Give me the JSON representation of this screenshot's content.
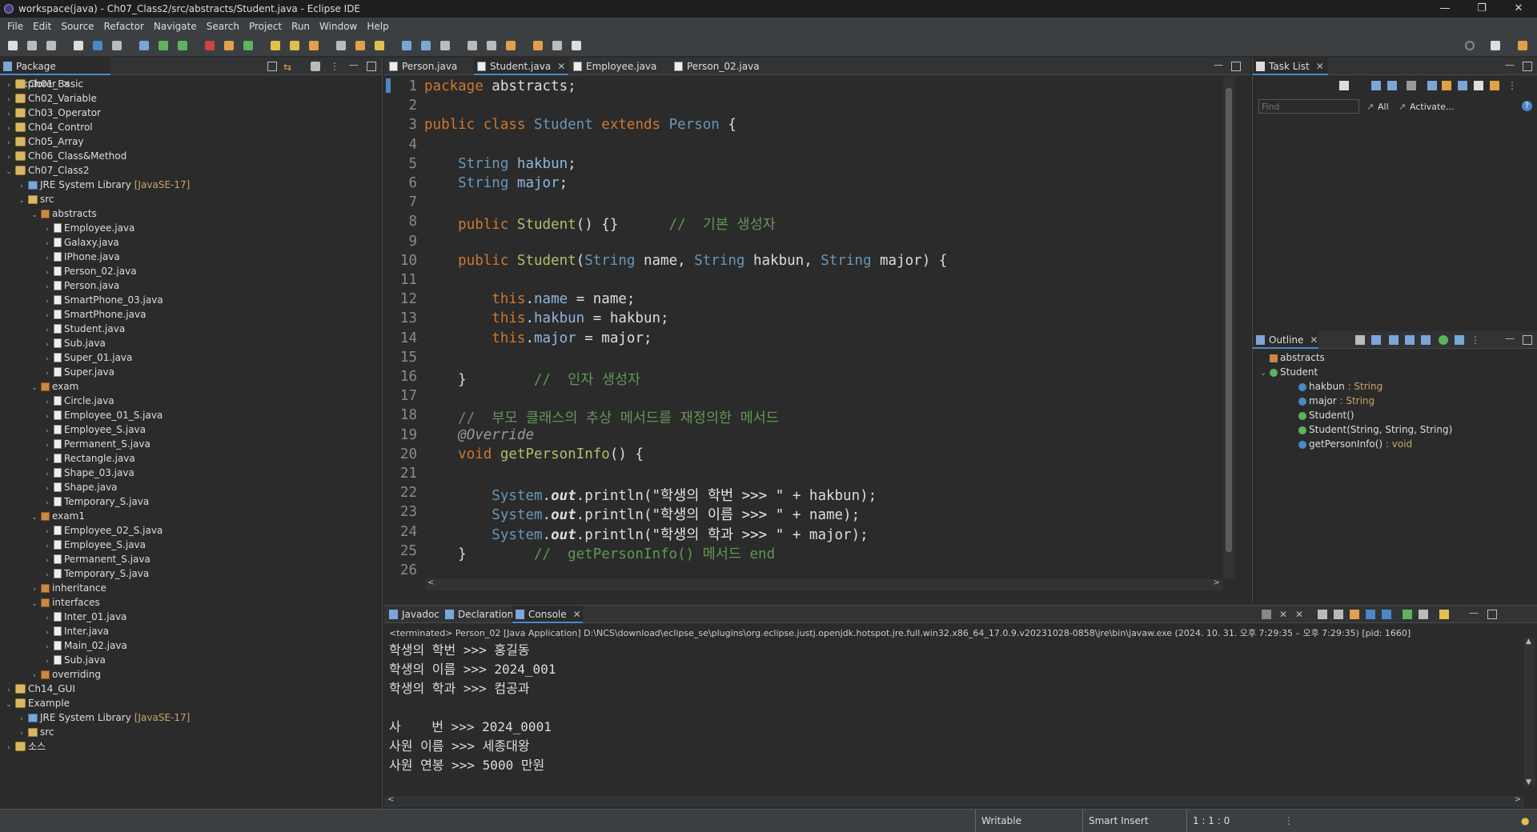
{
  "window": {
    "title": "workspace(java) - Ch07_Class2/src/abstracts/Student.java - Eclipse IDE"
  },
  "menu": {
    "items": [
      "File",
      "Edit",
      "Source",
      "Refactor",
      "Navigate",
      "Search",
      "Project",
      "Run",
      "Window",
      "Help"
    ]
  },
  "package_explorer": {
    "title": "Package Explorer",
    "rows": [
      {
        "label": "Ch01_Basic",
        "indent": 0,
        "icon": "project",
        "expanded": false
      },
      {
        "label": "Ch02_Variable",
        "indent": 0,
        "icon": "project",
        "expanded": false
      },
      {
        "label": "Ch03_Operator",
        "indent": 0,
        "icon": "project",
        "expanded": false
      },
      {
        "label": "Ch04_Control",
        "indent": 0,
        "icon": "project",
        "expanded": false
      },
      {
        "label": "Ch05_Array",
        "indent": 0,
        "icon": "project",
        "expanded": false
      },
      {
        "label": "Ch06_Class&Method",
        "indent": 0,
        "icon": "project",
        "expanded": false
      },
      {
        "label": "Ch07_Class2",
        "indent": 0,
        "icon": "project",
        "expanded": true
      },
      {
        "label": "JRE System Library",
        "note": "[JavaSE-17]",
        "indent": 1,
        "icon": "library",
        "expanded": false
      },
      {
        "label": "src",
        "indent": 1,
        "icon": "src",
        "expanded": true
      },
      {
        "label": "abstracts",
        "indent": 2,
        "icon": "package",
        "expanded": true
      },
      {
        "label": "Employee.java",
        "indent": 3,
        "icon": "file",
        "expanded": false
      },
      {
        "label": "Galaxy.java",
        "indent": 3,
        "icon": "file",
        "expanded": false
      },
      {
        "label": "IPhone.java",
        "indent": 3,
        "icon": "file",
        "expanded": false
      },
      {
        "label": "Person_02.java",
        "indent": 3,
        "icon": "file",
        "expanded": false
      },
      {
        "label": "Person.java",
        "indent": 3,
        "icon": "file",
        "expanded": false
      },
      {
        "label": "SmartPhone_03.java",
        "indent": 3,
        "icon": "file",
        "expanded": false
      },
      {
        "label": "SmartPhone.java",
        "indent": 3,
        "icon": "file",
        "expanded": false
      },
      {
        "label": "Student.java",
        "indent": 3,
        "icon": "file",
        "expanded": false
      },
      {
        "label": "Sub.java",
        "indent": 3,
        "icon": "file",
        "expanded": false
      },
      {
        "label": "Super_01.java",
        "indent": 3,
        "icon": "file",
        "expanded": false
      },
      {
        "label": "Super.java",
        "indent": 3,
        "icon": "file",
        "expanded": false
      },
      {
        "label": "exam",
        "indent": 2,
        "icon": "package",
        "expanded": true
      },
      {
        "label": "Circle.java",
        "indent": 3,
        "icon": "file",
        "expanded": false
      },
      {
        "label": "Employee_01_S.java",
        "indent": 3,
        "icon": "file",
        "expanded": false
      },
      {
        "label": "Employee_S.java",
        "indent": 3,
        "icon": "file",
        "expanded": false
      },
      {
        "label": "Permanent_S.java",
        "indent": 3,
        "icon": "file",
        "expanded": false
      },
      {
        "label": "Rectangle.java",
        "indent": 3,
        "icon": "file",
        "expanded": false
      },
      {
        "label": "Shape_03.java",
        "indent": 3,
        "icon": "file",
        "expanded": false
      },
      {
        "label": "Shape.java",
        "indent": 3,
        "icon": "file",
        "expanded": false
      },
      {
        "label": "Temporary_S.java",
        "indent": 3,
        "icon": "file",
        "expanded": false
      },
      {
        "label": "exam1",
        "indent": 2,
        "icon": "package",
        "expanded": true
      },
      {
        "label": "Employee_02_S.java",
        "indent": 3,
        "icon": "file",
        "expanded": false
      },
      {
        "label": "Employee_S.java",
        "indent": 3,
        "icon": "file",
        "expanded": false
      },
      {
        "label": "Permanent_S.java",
        "indent": 3,
        "icon": "file",
        "expanded": false
      },
      {
        "label": "Temporary_S.java",
        "indent": 3,
        "icon": "file",
        "expanded": false
      },
      {
        "label": "inheritance",
        "indent": 2,
        "icon": "package",
        "expanded": false
      },
      {
        "label": "interfaces",
        "indent": 2,
        "icon": "package",
        "expanded": true
      },
      {
        "label": "Inter_01.java",
        "indent": 3,
        "icon": "file",
        "expanded": false
      },
      {
        "label": "Inter.java",
        "indent": 3,
        "icon": "file",
        "expanded": false
      },
      {
        "label": "Main_02.java",
        "indent": 3,
        "icon": "file",
        "expanded": false
      },
      {
        "label": "Sub.java",
        "indent": 3,
        "icon": "file",
        "expanded": false
      },
      {
        "label": "overriding",
        "indent": 2,
        "icon": "package",
        "expanded": false
      },
      {
        "label": "Ch14_GUI",
        "indent": 0,
        "icon": "project",
        "expanded": false
      },
      {
        "label": "Example",
        "indent": 0,
        "icon": "project",
        "expanded": true
      },
      {
        "label": "JRE System Library",
        "note": "[JavaSE-17]",
        "indent": 1,
        "icon": "library",
        "expanded": false
      },
      {
        "label": "src",
        "indent": 1,
        "icon": "src",
        "expanded": false
      },
      {
        "label": "소스",
        "indent": 0,
        "icon": "project",
        "expanded": false
      }
    ]
  },
  "editor": {
    "tabs": [
      {
        "label": "Person.java",
        "active": false
      },
      {
        "label": "Student.java",
        "active": true
      },
      {
        "label": "Employee.java",
        "active": false
      },
      {
        "label": "Person_02.java",
        "active": false
      }
    ],
    "lines": [
      {
        "n": "1",
        "html": "<span class='kw'>package</span> abstracts;"
      },
      {
        "n": "2",
        "html": ""
      },
      {
        "n": "3",
        "html": "<span class='kw'>public class</span> <span class='ty'>Student</span> <span class='kw'>extends</span> <span class='ty'>Person</span> {"
      },
      {
        "n": "4",
        "html": ""
      },
      {
        "n": "5",
        "html": "    <span class='ty'>String</span> <span class='fd'>hakbun</span>;"
      },
      {
        "n": "6",
        "html": "    <span class='ty'>String</span> <span class='fd'>major</span>;"
      },
      {
        "n": "7",
        "html": ""
      },
      {
        "n": "8",
        "html": "    <span class='kw'>public</span> <span class='fn'>Student</span>() {}      <span class='cm'>//  기본 생성자</span>"
      },
      {
        "n": "9",
        "html": ""
      },
      {
        "n": "10",
        "html": "    <span class='kw'>public</span> <span class='fn'>Student</span>(<span class='ty'>String</span> name, <span class='ty'>String</span> hakbun, <span class='ty'>String</span> major) {"
      },
      {
        "n": "11",
        "html": ""
      },
      {
        "n": "12",
        "html": "        <span class='kw'>this</span>.<span class='fd'>name</span> = name;"
      },
      {
        "n": "13",
        "html": "        <span class='kw'>this</span>.<span class='fd'>hakbun</span> = hakbun;"
      },
      {
        "n": "14",
        "html": "        <span class='kw'>this</span>.<span class='fd'>major</span> = major;"
      },
      {
        "n": "15",
        "html": ""
      },
      {
        "n": "16",
        "html": "    }        <span class='cm'>//  인자 생성자</span>"
      },
      {
        "n": "17",
        "html": ""
      },
      {
        "n": "18",
        "html": "    <span class='cm'>//  부모 클래스의 추상 메서드를 재정의한 메서드</span>"
      },
      {
        "n": "19",
        "html": "    <span class='an'>@Override</span>"
      },
      {
        "n": "20",
        "html": "    <span class='kw'>void</span> <span class='fn'>getPersonInfo</span>() {"
      },
      {
        "n": "21",
        "html": ""
      },
      {
        "n": "22",
        "html": "        <span class='ty'>System</span>.<span class='stat'>out</span>.println(<span class='st'>\"학생의 학번 >>> \"</span> + hakbun);"
      },
      {
        "n": "23",
        "html": "        <span class='ty'>System</span>.<span class='stat'>out</span>.println(<span class='st'>\"학생의 이름 >>> \"</span> + name);"
      },
      {
        "n": "24",
        "html": "        <span class='ty'>System</span>.<span class='stat'>out</span>.println(<span class='st'>\"학생의 학과 >>> \"</span> + major);"
      },
      {
        "n": "25",
        "html": "    }        <span class='cm'>//  getPersonInfo() 메서드 end</span>"
      },
      {
        "n": "26",
        "html": ""
      },
      {
        "n": "27",
        "html": "}"
      }
    ]
  },
  "task_list": {
    "title": "Task List",
    "find_placeholder": "Find",
    "all_label": "All",
    "activate_label": "Activate..."
  },
  "outline": {
    "title": "Outline",
    "items": [
      {
        "label": "abstracts",
        "type": "",
        "indent": 0,
        "icon": "package"
      },
      {
        "label": "Student",
        "type": "",
        "indent": 0,
        "icon": "class"
      },
      {
        "label": "hakbun",
        "type": " : String",
        "indent": 1,
        "icon": "field"
      },
      {
        "label": "major",
        "type": " : String",
        "indent": 1,
        "icon": "field"
      },
      {
        "label": "Student()",
        "type": "",
        "indent": 1,
        "icon": "constructor"
      },
      {
        "label": "Student(String, String, String)",
        "type": "",
        "indent": 1,
        "icon": "constructor"
      },
      {
        "label": "getPersonInfo()",
        "type": " : void",
        "indent": 1,
        "icon": "method"
      }
    ]
  },
  "bottom": {
    "tabs": [
      {
        "label": "Javadoc",
        "active": false
      },
      {
        "label": "Declaration",
        "active": false
      },
      {
        "label": "Console",
        "active": true
      }
    ],
    "header": "<terminated> Person_02 [Java Application] D:\\NCS\\download\\eclipse_se\\plugins\\org.eclipse.justj.openjdk.hotspot.jre.full.win32.x86_64_17.0.9.v20231028-0858\\jre\\bin\\javaw.exe  (2024. 10. 31. 오후 7:29:35 – 오후 7:29:35) [pid: 1660]",
    "lines": [
      "학생의 학번 >>> 홍길동",
      "학생의 이름 >>> 2024_001",
      "학생의 학과 >>> 컴공과",
      "",
      "사    번 >>> 2024_0001",
      "사원 이름 >>> 세종대왕",
      "사원 연봉 >>> 5000 만원"
    ]
  },
  "status": {
    "writable": "Writable",
    "insert_mode": "Smart Insert",
    "position": "1 : 1 : 0"
  },
  "colors": {
    "accent": "#4a88c7",
    "keyword": "#cc7832",
    "type": "#6897bb",
    "comment": "#629755"
  }
}
